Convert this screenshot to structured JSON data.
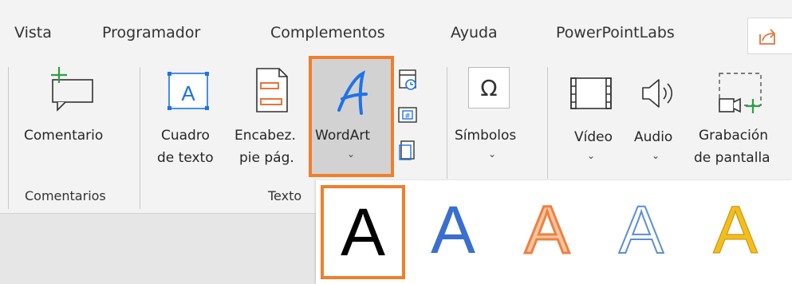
{
  "tabs": [
    "Vista",
    "Programador",
    "Complementos",
    "Ayuda",
    "PowerPointLabs"
  ],
  "share_icon": "share-icon",
  "commands": {
    "comment": "Comentario",
    "textbox": [
      "Cuadro",
      "de texto"
    ],
    "header_footer": [
      "Encabez.",
      "pie pág."
    ],
    "wordart": "WordArt",
    "symbols": "Símbolos",
    "video": "Vídeo",
    "audio": "Audio",
    "screen_recording": [
      "Grabación",
      "de pantalla"
    ]
  },
  "groups": {
    "comments": "Comentarios",
    "text": "Texto"
  },
  "icons": {
    "textbox_letter": "A",
    "symbol_glyph": "Ω",
    "chevron": "⌄"
  },
  "wordart_styles": [
    {
      "letter": "A",
      "style": "black-fill"
    },
    {
      "letter": "A",
      "style": "blue-fill"
    },
    {
      "letter": "A",
      "style": "orange-outline-gradient"
    },
    {
      "letter": "A",
      "style": "blue-outline"
    },
    {
      "letter": "A",
      "style": "gold-gradient"
    }
  ],
  "colors": {
    "accent_orange": "#f07f2d",
    "green": "#2ea043",
    "blue": "#1e73e8"
  }
}
